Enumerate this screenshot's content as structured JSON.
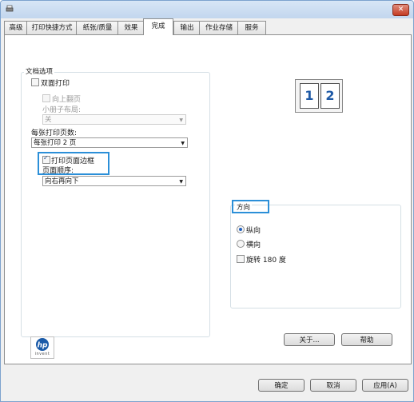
{
  "window": {
    "close_glyph": "✕"
  },
  "tabs": [
    "高级",
    "打印快捷方式",
    "纸张/质量",
    "效果",
    "完成",
    "输出",
    "作业存储",
    "服务"
  ],
  "doc_options": {
    "group_label": "文档选项",
    "duplex_label": "双面打印",
    "flip_up_label": "向上翻页",
    "booklet_layout_label": "小册子布局:",
    "booklet_value": "关",
    "pages_per_sheet_label": "每张打印页数:",
    "pages_per_sheet_value": "每张打印 2 页",
    "print_borders_label": "打印页面边框",
    "page_order_label": "页面顺序:",
    "page_order_value": "向右再向下"
  },
  "preview": {
    "page1": "1",
    "page2": "2"
  },
  "orientation": {
    "group_label": "方向",
    "portrait_label": "纵向",
    "landscape_label": "横向",
    "rotate_label": "旋转 180 度"
  },
  "buttons": {
    "about": "关于...",
    "help": "帮助",
    "ok": "确定",
    "cancel": "取消",
    "apply": "应用(A)"
  },
  "logo": {
    "brand": "hp",
    "tagline": "invent"
  },
  "colors": {
    "highlight": "#2b8fd8"
  }
}
